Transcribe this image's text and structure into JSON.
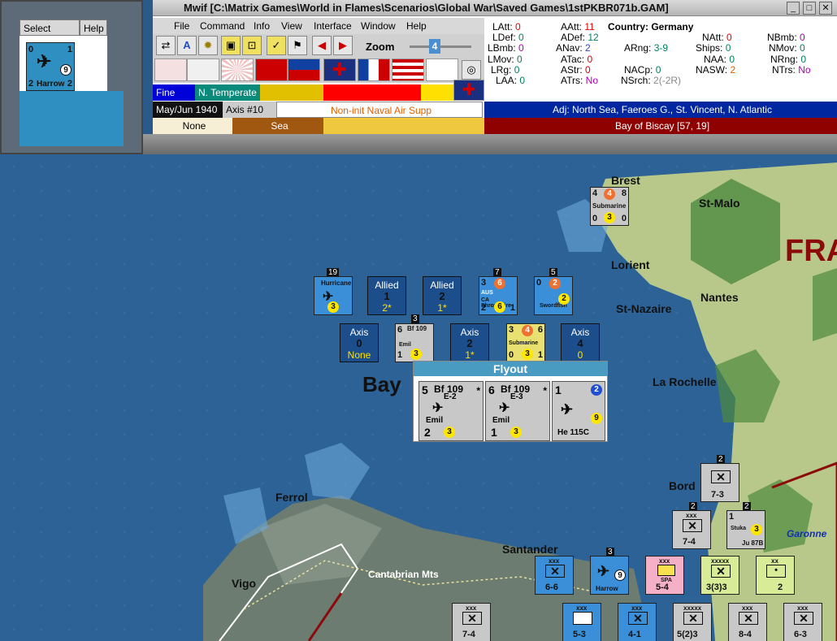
{
  "window": {
    "title": "Mwif [C:\\Matrix Games\\World in Flames\\Scenarios\\Global War\\Saved Games\\1stPKBR071b.GAM]"
  },
  "select_window": {
    "tabs": [
      "Select",
      "Help"
    ],
    "unit": {
      "top_left": "0",
      "top_right": "1",
      "bottom_left": "2",
      "name": "Harrow",
      "bottom_right": "2",
      "badge": "9"
    }
  },
  "menu": [
    "File",
    "Command",
    "Info",
    "View",
    "Interface",
    "Window",
    "Help"
  ],
  "toolbar": {
    "zoom_label": "Zoom",
    "zoom_value": "4"
  },
  "info": {
    "rows": [
      [
        {
          "k": "LAtt:",
          "v": "0",
          "c": "v0"
        },
        {
          "k": "AAtt:",
          "v": "11",
          "c": "v0"
        },
        {
          "k": "Country:",
          "v": "Germany",
          "c": ""
        }
      ],
      [
        {
          "k": "LDef:",
          "v": "0",
          "c": "v1"
        },
        {
          "k": "ADef:",
          "v": "12",
          "c": "v1"
        },
        {
          "k": "NAtt:",
          "v": "0",
          "c": "v0"
        },
        {
          "k": "NBmb:",
          "v": "0",
          "c": "v3"
        }
      ],
      [
        {
          "k": "LBmb:",
          "v": "0",
          "c": "v3"
        },
        {
          "k": "ANav:",
          "v": "2",
          "c": "v2"
        },
        {
          "k": "ARng:",
          "v": "3-9",
          "c": "v1"
        },
        {
          "k": "Ships:",
          "v": "0",
          "c": "v1"
        },
        {
          "k": "NMov:",
          "v": "0",
          "c": "v1"
        }
      ],
      [
        {
          "k": "LMov:",
          "v": "0",
          "c": "v1"
        },
        {
          "k": "ATac:",
          "v": "0",
          "c": "v0"
        },
        {
          "k": "NAA:",
          "v": "0",
          "c": "v1"
        },
        {
          "k": "NRng:",
          "v": "0",
          "c": "v1"
        }
      ],
      [
        {
          "k": "LRg:",
          "v": "0",
          "c": "v1"
        },
        {
          "k": "AStr:",
          "v": "0",
          "c": "v0"
        },
        {
          "k": "NACp:",
          "v": "0",
          "c": "v1"
        },
        {
          "k": "NASW:",
          "v": "2",
          "c": "v4"
        },
        {
          "k": "NTrs:",
          "v": "No",
          "c": "v3"
        }
      ],
      [
        {
          "k": "LAA:",
          "v": "0",
          "c": "v1"
        },
        {
          "k": "ATrs:",
          "v": "No",
          "c": "v3"
        },
        {
          "k": "NSrch:",
          "v": "2(-2R)",
          "c": "vg"
        }
      ]
    ]
  },
  "status": {
    "weather": "Fine",
    "climate": "N. Temperate",
    "date": "May/Jun 1940",
    "turn": "Axis #10",
    "phase": "Non-init Naval Air Supp",
    "adjacent": "Adj: North Sea, Faeroes G., St. Vincent, N. Atlantic",
    "terrain1": "None",
    "terrain2": "Sea",
    "location": "Bay of Biscay [57, 19]"
  },
  "map": {
    "labels": {
      "brest": "Brest",
      "stmalo": "St-Malo",
      "lorient": "Lorient",
      "nantes": "Nantes",
      "stnazaire": "St-Nazaire",
      "larochelle": "La Rochelle",
      "bay": "Bay",
      "france": "FRA",
      "ferrol": "Ferrol",
      "santander": "Santander",
      "cantabrian": "Cantabrian Mts",
      "vigo": "Vigo",
      "bord": "Bord",
      "garonne": "Garonne"
    },
    "summaries": [
      {
        "side": "Allied",
        "num": "1",
        "sub": "2*"
      },
      {
        "side": "Allied",
        "num": "2",
        "sub": "1*"
      },
      {
        "side": "Axis",
        "num": "0",
        "sub": "None"
      },
      {
        "side": "Axis",
        "num": "2",
        "sub": "1*"
      },
      {
        "side": "Axis",
        "num": "4",
        "sub": "0"
      }
    ],
    "units": {
      "hurricane": {
        "name": "Hurricane",
        "badge": "19",
        "circle": "3"
      },
      "shropshire": {
        "name": "CA Shropshire",
        "badge": "7",
        "tl": "3",
        "top": "6",
        "bl": "2",
        "circle": "6",
        "br": "1",
        "flag": "AUS"
      },
      "swordfish": {
        "name": "Swordfish",
        "badge": "5",
        "tl": "0",
        "top": "2",
        "circle": "2"
      },
      "bf109": {
        "name": "Bf 109",
        "sub": "Emil",
        "badge": "3",
        "tl": "6",
        "bl": "1",
        "circle": "3"
      },
      "sub_mid": {
        "name": "Submarine",
        "tl": "3",
        "top": "4",
        "tr": "6",
        "bl": "0",
        "circle": "3",
        "br": "1"
      },
      "sub_brest": {
        "name": "Submarine",
        "tl": "4",
        "top": "4",
        "tr": "8",
        "bl": "0",
        "circle": "3",
        "br": "0"
      },
      "inf1": {
        "val": "7-3",
        "badge": "2"
      },
      "inf2": {
        "val": "7-4",
        "badge": "2",
        "size": "xxx"
      },
      "stuka": {
        "name": "Stuka",
        "sub": "Ju 87B",
        "tl": "1",
        "circle": "3",
        "badge": "2"
      },
      "bot": [
        {
          "val": "6-6",
          "size": "xxx"
        },
        {
          "val": "Harrow",
          "badge": "3",
          "circle": "9"
        },
        {
          "val": "5-4",
          "size": "xxx",
          "sub": "SPA"
        },
        {
          "val": "3(3)3",
          "size": "xxxxx"
        },
        {
          "val": "2",
          "size": "xx"
        },
        {
          "val": "7-4",
          "size": "xxx"
        },
        {
          "val": "5-3",
          "size": "xxx"
        },
        {
          "val": "4-1",
          "size": "xxx"
        },
        {
          "val": "5(2)3",
          "size": "xxxxx"
        },
        {
          "val": "8-4",
          "size": "xxx"
        },
        {
          "val": "6-3",
          "size": "xxx"
        }
      ]
    }
  },
  "flyout": {
    "title": "Flyout",
    "units": [
      {
        "tl": "5",
        "name": "Bf 109",
        "sub": "E-2",
        "star": "*",
        "pilot": "Emil",
        "bl": "2",
        "circle": "3"
      },
      {
        "tl": "6",
        "name": "Bf 109",
        "sub": "E-3",
        "star": "*",
        "pilot": "Emil",
        "bl": "1",
        "circle": "3"
      },
      {
        "tl": "1",
        "name": "He 115C",
        "circle_top": "2",
        "circle": "9"
      }
    ]
  },
  "colors": {
    "allied": "#1d4e8c",
    "axis_bg": "#c8c8c8",
    "sub_yellow": "#e8e070",
    "status_blue": "#0026a0",
    "status_red": "#8f0000"
  }
}
